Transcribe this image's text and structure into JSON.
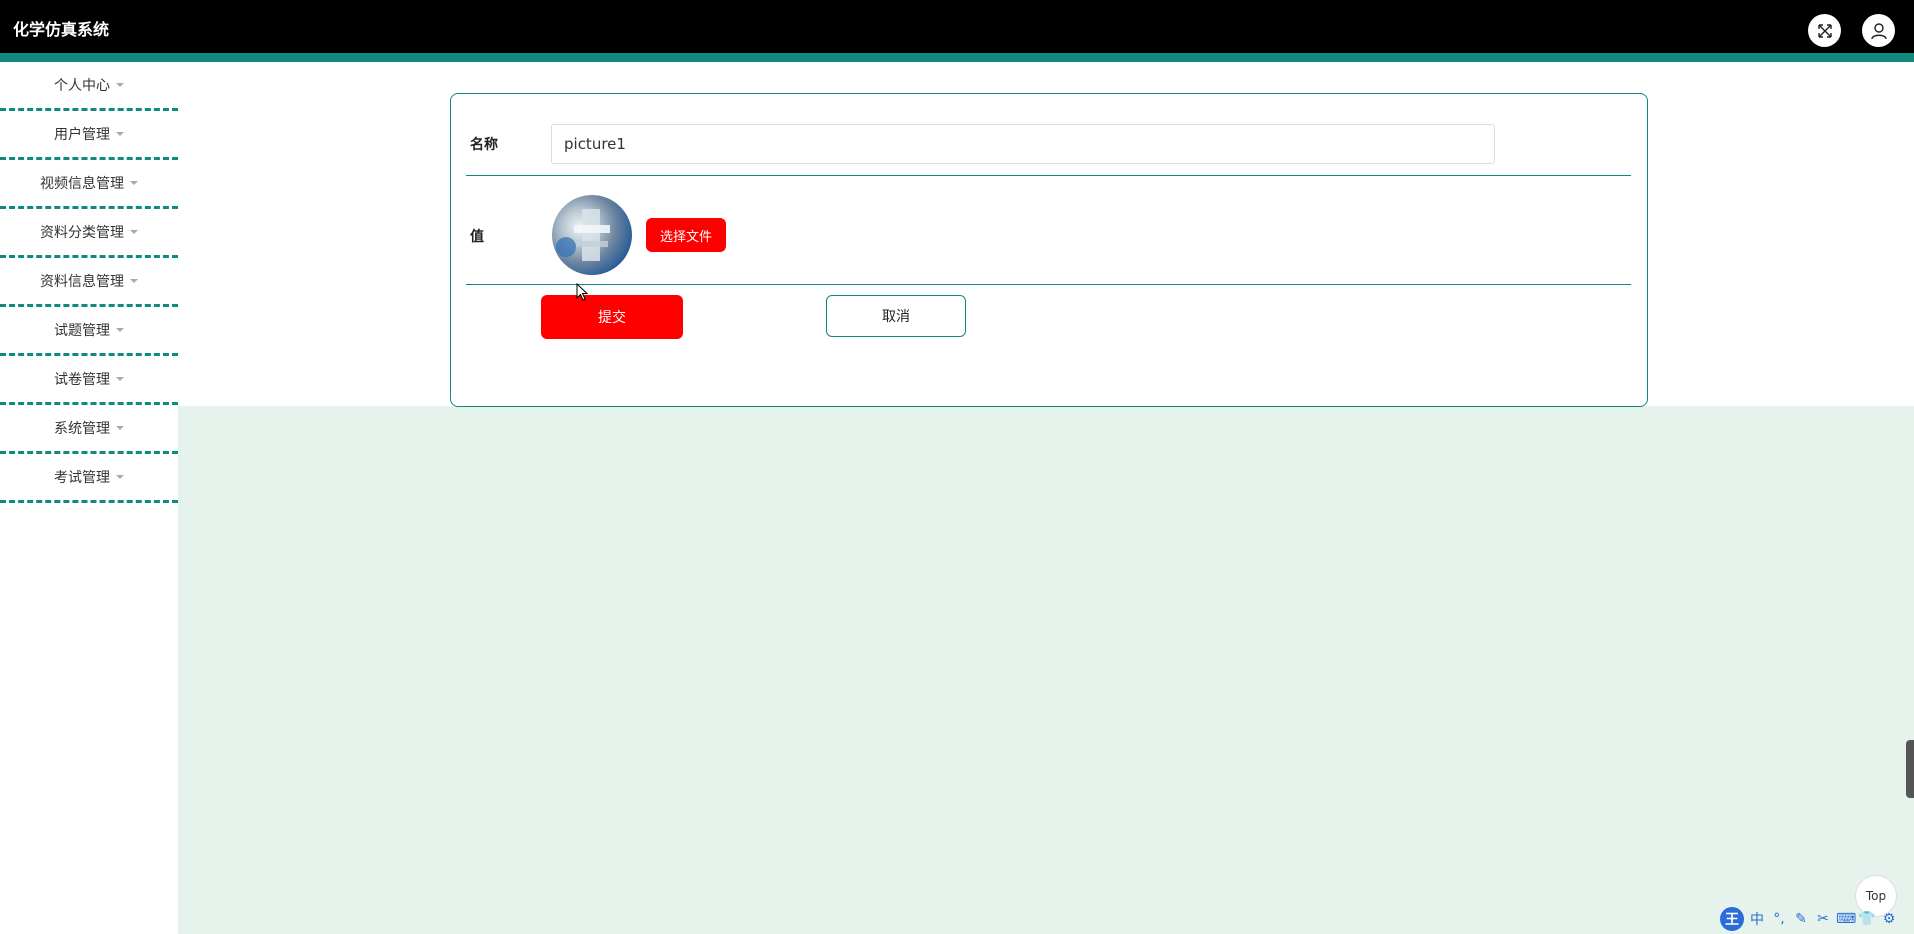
{
  "app": {
    "title": "化学仿真系统"
  },
  "header": {
    "fullscreen_icon": "expand-arrows-icon",
    "user_icon": "user-icon"
  },
  "sidebar": {
    "items": [
      {
        "label": "个人中心"
      },
      {
        "label": "用户管理"
      },
      {
        "label": "视频信息管理"
      },
      {
        "label": "资料分类管理"
      },
      {
        "label": "资料信息管理"
      },
      {
        "label": "试题管理"
      },
      {
        "label": "试卷管理"
      },
      {
        "label": "系统管理"
      },
      {
        "label": "考试管理"
      }
    ]
  },
  "form": {
    "name_label": "名称",
    "name_value": "picture1",
    "value_label": "值",
    "choose_file_label": "选择文件",
    "submit_label": "提交",
    "cancel_label": "取消"
  },
  "widgets": {
    "top_label": "Top"
  },
  "ime": {
    "logo": "王",
    "glyphs": [
      "中",
      "°,",
      "✎",
      "✂",
      "⌨",
      "👕",
      "⚙"
    ]
  },
  "colors": {
    "accent": "#0f8a7e",
    "primary_button": "#ff0000",
    "content_background": "#e6f3ec",
    "header": "#000000"
  }
}
